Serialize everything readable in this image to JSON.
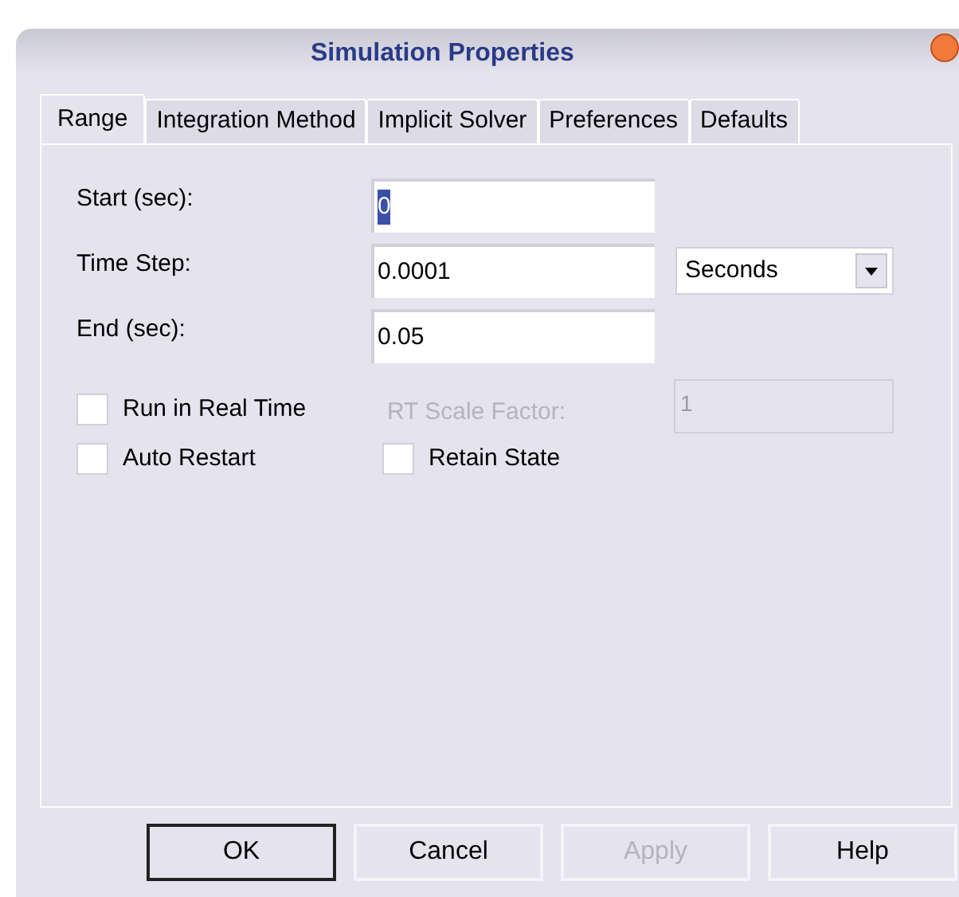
{
  "window": {
    "title": "Simulation Properties"
  },
  "tabs": [
    {
      "label": "Range",
      "selected": true
    },
    {
      "label": "Integration Method",
      "selected": false
    },
    {
      "label": "Implicit Solver",
      "selected": false
    },
    {
      "label": "Preferences",
      "selected": false
    },
    {
      "label": "Defaults",
      "selected": false
    }
  ],
  "fields": [
    {
      "label": "Start (sec):",
      "value": "0",
      "text_selected": true
    },
    {
      "label": "Time Step:",
      "value": "0.0001",
      "text_selected": false,
      "unit": "Seconds"
    },
    {
      "label": "End (sec):",
      "value": "0.05",
      "text_selected": false
    }
  ],
  "options": [
    {
      "label": "Run in Real Time",
      "checked": false
    },
    {
      "label": "Auto Restart",
      "checked": false
    },
    {
      "label": "Retain State",
      "checked": false
    }
  ],
  "scale_factor": {
    "label": "RT Scale Factor:",
    "value": "1",
    "disabled": true
  },
  "buttons": [
    {
      "label": "OK",
      "default": true,
      "disabled": false
    },
    {
      "label": "Cancel",
      "default": false,
      "disabled": false
    },
    {
      "label": "Apply",
      "default": false,
      "disabled": true
    },
    {
      "label": "Help",
      "default": false,
      "disabled": false
    }
  ]
}
